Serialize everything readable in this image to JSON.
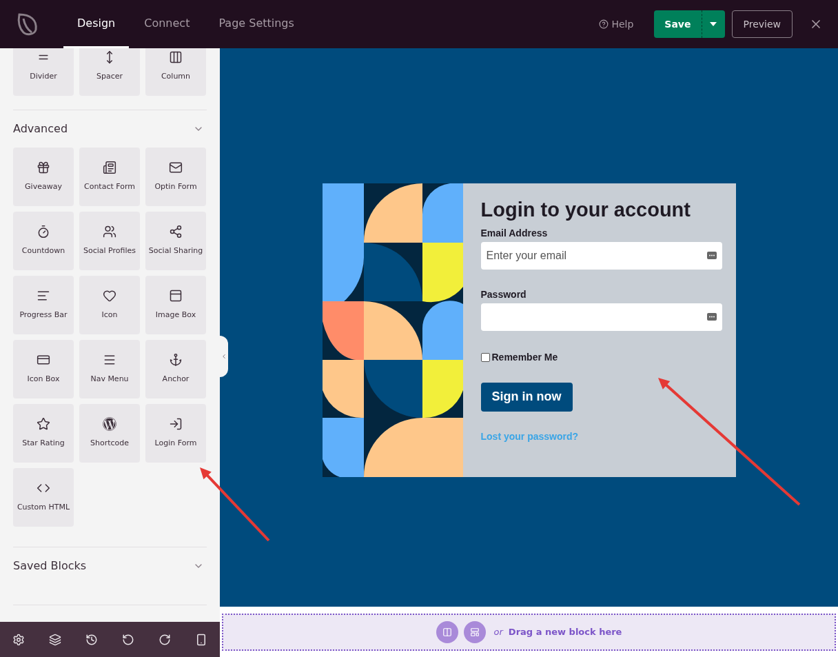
{
  "topbar": {
    "tabs": [
      {
        "label": "Design",
        "selected": true
      },
      {
        "label": "Connect",
        "selected": false
      },
      {
        "label": "Page Settings",
        "selected": false
      }
    ],
    "help": "Help",
    "save": "Save",
    "preview": "Preview"
  },
  "sidebar": {
    "top_blocks": [
      "Divider",
      "Spacer",
      "Column"
    ],
    "sections": [
      {
        "title": "Advanced",
        "blocks": [
          "Giveaway",
          "Contact Form",
          "Optin Form",
          "Countdown",
          "Social Profiles",
          "Social Sharing",
          "Progress Bar",
          "Icon",
          "Image Box",
          "Icon Box",
          "Nav Menu",
          "Anchor",
          "Star Rating",
          "Shortcode",
          "Login Form",
          "Custom HTML"
        ]
      },
      {
        "title": "Saved Blocks"
      }
    ]
  },
  "login_form": {
    "title": "Login to your account",
    "email_label": "Email Address",
    "email_placeholder": "Enter your email",
    "password_label": "Password",
    "remember_label": "Remember Me",
    "remember_checked": false,
    "submit": "Sign in now",
    "lost_password": "Lost your password?"
  },
  "drop_zone": {
    "or": "or",
    "text": "Drag a new block here"
  }
}
